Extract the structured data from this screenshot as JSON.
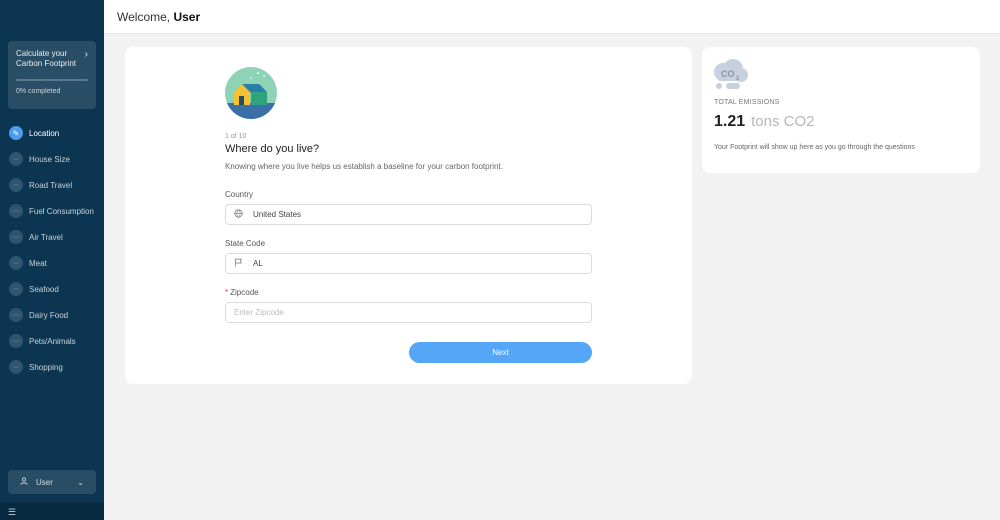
{
  "sidebar": {
    "promo_title": "Calculate your Carbon Footprint",
    "promo_status": "0% completed",
    "progress_percent": 0,
    "steps": [
      {
        "label": "Location",
        "active": true
      },
      {
        "label": "House Size"
      },
      {
        "label": "Road Travel"
      },
      {
        "label": "Fuel Consumption"
      },
      {
        "label": "Air Travel"
      },
      {
        "label": "Meat"
      },
      {
        "label": "Seafood"
      },
      {
        "label": "Dairy Food"
      },
      {
        "label": "Pets/Animals"
      },
      {
        "label": "Shopping"
      }
    ],
    "user_label": "User"
  },
  "header": {
    "welcome_prefix": "Welcome, ",
    "user_name": "User"
  },
  "form": {
    "step_counter": "1 of 10",
    "title": "Where do you live?",
    "description": "Knowing where you live helps us establish a baseline for your carbon footprint.",
    "country_label": "Country",
    "country_value": "United States",
    "state_label": "State Code",
    "state_value": "AL",
    "zip_required_mark": "*",
    "zip_label": "Zipcode",
    "zip_placeholder": "Enter Zipcode",
    "next_label": "Next"
  },
  "emissions": {
    "label": "TOTAL EMISSIONS",
    "value": "1.21",
    "unit": "tons CO2",
    "note": "Your Footprint will show up here as you go through the questions"
  },
  "colors": {
    "sidebar_bg": "#0b3551",
    "accent": "#55a6f6",
    "page_bg": "#f2f2f2"
  }
}
